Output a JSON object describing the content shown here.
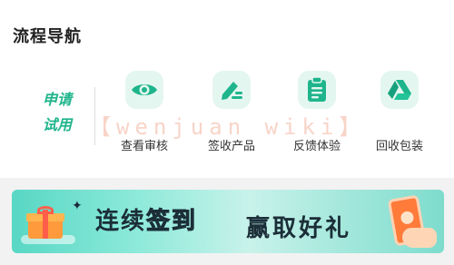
{
  "header": {
    "title": "流程导航"
  },
  "trial": {
    "line1": "申请",
    "line2": "试用"
  },
  "watermark": "【wenjuan wiki】",
  "nav": [
    {
      "label": "查看审核",
      "icon": "eye-icon"
    },
    {
      "label": "签收产品",
      "icon": "sign-pen-icon"
    },
    {
      "label": "反馈体验",
      "icon": "clipboard-icon"
    },
    {
      "label": "回收包装",
      "icon": "recycle-triangle-icon"
    }
  ],
  "banner": {
    "part1": "连续",
    "part2": "签到",
    "part3": "赢取好礼"
  },
  "colors": {
    "accent": "#1fb58c",
    "icon_bg": "#e4f6f0",
    "banner_orange": "#ff8a1f"
  }
}
